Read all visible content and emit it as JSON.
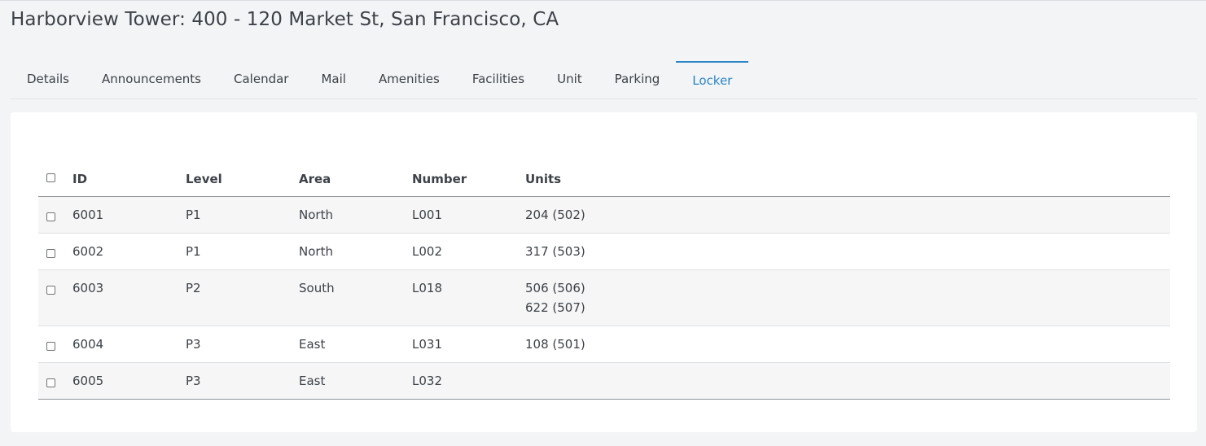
{
  "page": {
    "title": "Harborview Tower: 400 - 120 Market St, San Francisco, CA"
  },
  "tabs": [
    {
      "label": "Details",
      "active": false
    },
    {
      "label": "Announcements",
      "active": false
    },
    {
      "label": "Calendar",
      "active": false
    },
    {
      "label": "Mail",
      "active": false
    },
    {
      "label": "Amenities",
      "active": false
    },
    {
      "label": "Facilities",
      "active": false
    },
    {
      "label": "Unit",
      "active": false
    },
    {
      "label": "Parking",
      "active": false
    },
    {
      "label": "Locker",
      "active": true
    }
  ],
  "table": {
    "headers": {
      "id": "ID",
      "level": "Level",
      "area": "Area",
      "number": "Number",
      "units": "Units"
    },
    "rows": [
      {
        "id": "6001",
        "level": "P1",
        "area": "North",
        "number": "L001",
        "units": [
          "204 (502)"
        ]
      },
      {
        "id": "6002",
        "level": "P1",
        "area": "North",
        "number": "L002",
        "units": [
          "317 (503)"
        ]
      },
      {
        "id": "6003",
        "level": "P2",
        "area": "South",
        "number": "L018",
        "units": [
          "506 (506)",
          "622 (507)"
        ]
      },
      {
        "id": "6004",
        "level": "P3",
        "area": "East",
        "number": "L031",
        "units": [
          "108 (501)"
        ]
      },
      {
        "id": "6005",
        "level": "P3",
        "area": "East",
        "number": "L032",
        "units": []
      }
    ]
  },
  "colors": {
    "accent": "#2a84c6",
    "background": "#f3f4f6",
    "card": "#ffffff",
    "row_stripe": "#f6f6f6"
  }
}
